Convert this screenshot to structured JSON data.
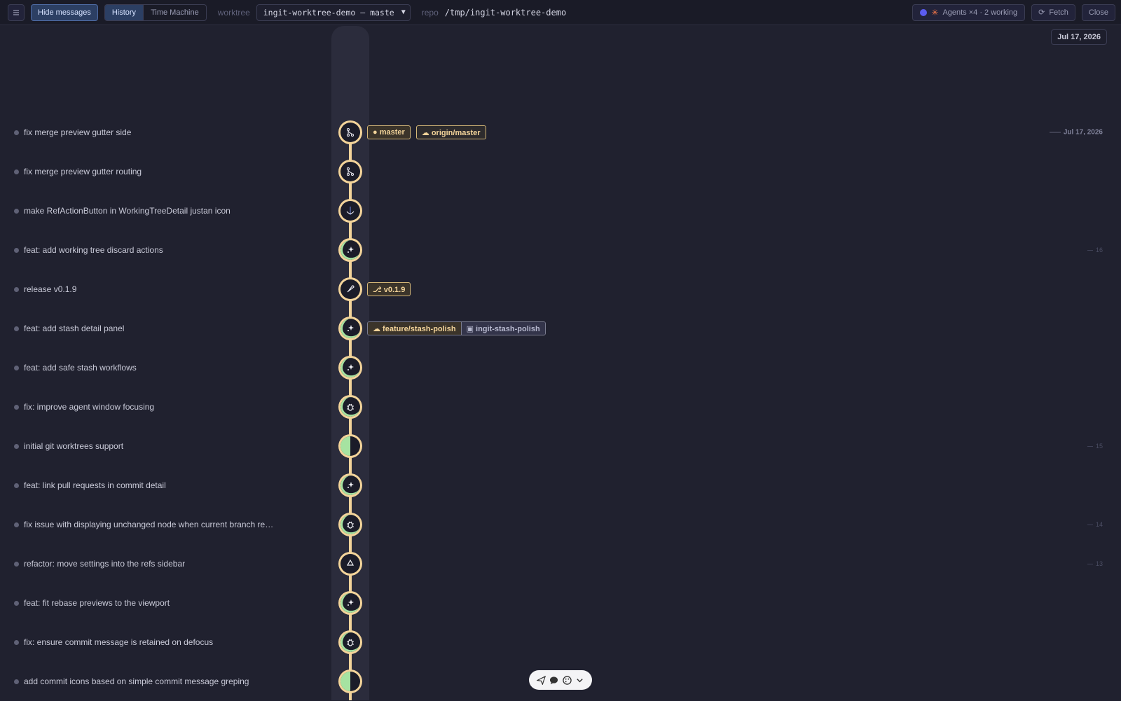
{
  "toolbar": {
    "hide_messages": "Hide messages",
    "tabs": [
      "History",
      "Time Machine"
    ],
    "worktree_label": "worktree",
    "worktree_value": "ingit-worktree-demo — maste",
    "repo_label": "repo",
    "repo_path": "/tmp/ingit-worktree-demo",
    "agents_label": "Agents ×4 · 2 working",
    "fetch_label": "Fetch",
    "close_label": "Close"
  },
  "header_date": "Jul 17, 2026",
  "commits": [
    {
      "message": "fix merge preview gutter side",
      "icon": "merge-icon",
      "refs": [
        "● master",
        "☁ origin/master"
      ],
      "day": "Jul 17, 2026"
    },
    {
      "message": "fix merge preview gutter routing",
      "icon": "merge-icon"
    },
    {
      "message": "make RefActionButton in WorkingTreeDetail justan icon",
      "icon": "anchor-icon"
    },
    {
      "message": "feat: add working tree discard actions",
      "icon": "sparkle-icon",
      "day": "16"
    },
    {
      "message": "release v0.1.9",
      "icon": "rocket-icon",
      "tag": "⎇ v0.1.9"
    },
    {
      "message": "feat: add stash detail panel",
      "icon": "sparkle-icon",
      "branch_group": [
        "☁ feature/stash-polish",
        "▣ ingit-stash-polish"
      ]
    },
    {
      "message": "feat: add safe stash workflows",
      "icon": "sparkle-icon"
    },
    {
      "message": "fix: improve agent window focusing",
      "icon": "bug-icon"
    },
    {
      "message": "initial git worktrees support",
      "icon": "half-circle-icon",
      "day": "15"
    },
    {
      "message": "feat: link pull requests in commit detail",
      "icon": "sparkle-icon"
    },
    {
      "message": "fix issue with displaying unchanged node when current branch re…",
      "icon": "bug-icon",
      "day": "14"
    },
    {
      "message": "refactor: move settings into the refs sidebar",
      "icon": "recycle-icon",
      "day": "13"
    },
    {
      "message": "feat: fit rebase previews to the viewport",
      "icon": "sparkle-icon"
    },
    {
      "message": "fix: ensure commit message is retained on defocus",
      "icon": "bug-icon"
    },
    {
      "message": "add commit icons based on simple commit message greping",
      "icon": "half-circle-icon"
    }
  ],
  "colors": {
    "graph": "#f3d49a",
    "accent": "#2c3f63",
    "background": "#20212f"
  }
}
